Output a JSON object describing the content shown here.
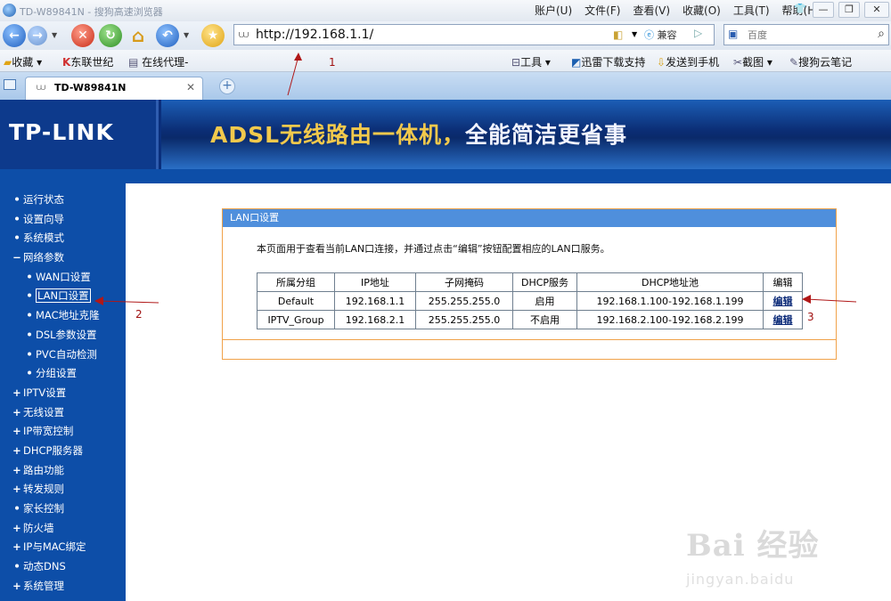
{
  "window": {
    "title": "TD-W89841N - 搜狗高速浏览器",
    "menu": [
      "账户(U)",
      "文件(F)",
      "查看(V)",
      "收藏(O)",
      "工具(T)",
      "帮助(H)"
    ]
  },
  "address_bar": {
    "url": "http://192.168.1.1/",
    "compat_label": "兼容",
    "search_placeholder": "百度"
  },
  "bookmarks": {
    "left": [
      "收藏",
      "东联世纪",
      "在线代理-"
    ],
    "right": [
      "工具",
      "迅雷下载支持",
      "发送到手机",
      "截图",
      "搜狗云笔记"
    ]
  },
  "tab": {
    "label": "TD-W89841N"
  },
  "router": {
    "logo": "TP-LINK",
    "banner_part1": "ADSL无线路由一体机，",
    "banner_part2": "全能简洁更省事"
  },
  "sidebar": {
    "items": [
      {
        "bullet": "•",
        "label": "运行状态",
        "sub": false,
        "selected": false
      },
      {
        "bullet": "•",
        "label": "设置向导",
        "sub": false,
        "selected": false
      },
      {
        "bullet": "•",
        "label": "系统模式",
        "sub": false,
        "selected": false
      },
      {
        "bullet": "−",
        "label": "网络参数",
        "sub": false,
        "selected": false
      },
      {
        "bullet": "•",
        "label": "WAN口设置",
        "sub": true,
        "selected": false
      },
      {
        "bullet": "•",
        "label": "LAN口设置",
        "sub": true,
        "selected": true
      },
      {
        "bullet": "•",
        "label": "MAC地址克隆",
        "sub": true,
        "selected": false
      },
      {
        "bullet": "•",
        "label": "DSL参数设置",
        "sub": true,
        "selected": false
      },
      {
        "bullet": "•",
        "label": "PVC自动检测",
        "sub": true,
        "selected": false
      },
      {
        "bullet": "•",
        "label": "分组设置",
        "sub": true,
        "selected": false
      },
      {
        "bullet": "+",
        "label": "IPTV设置",
        "sub": false,
        "selected": false
      },
      {
        "bullet": "+",
        "label": "无线设置",
        "sub": false,
        "selected": false
      },
      {
        "bullet": "+",
        "label": "IP带宽控制",
        "sub": false,
        "selected": false
      },
      {
        "bullet": "+",
        "label": "DHCP服务器",
        "sub": false,
        "selected": false
      },
      {
        "bullet": "+",
        "label": "路由功能",
        "sub": false,
        "selected": false
      },
      {
        "bullet": "+",
        "label": "转发规则",
        "sub": false,
        "selected": false
      },
      {
        "bullet": "•",
        "label": "家长控制",
        "sub": false,
        "selected": false
      },
      {
        "bullet": "+",
        "label": "防火墙",
        "sub": false,
        "selected": false
      },
      {
        "bullet": "+",
        "label": "IP与MAC绑定",
        "sub": false,
        "selected": false
      },
      {
        "bullet": "•",
        "label": "动态DNS",
        "sub": false,
        "selected": false
      },
      {
        "bullet": "+",
        "label": "系统管理",
        "sub": false,
        "selected": false
      }
    ]
  },
  "panel": {
    "title": "LAN口设置",
    "description": "本页面用于查看当前LAN口连接，并通过点击“编辑”按钮配置相应的LAN口服务。",
    "headers": [
      "所属分组",
      "IP地址",
      "子网掩码",
      "DHCP服务",
      "DHCP地址池",
      "编辑"
    ],
    "rows": [
      [
        "Default",
        "192.168.1.1",
        "255.255.255.0",
        "启用",
        "192.168.1.100-192.168.1.199",
        "编辑"
      ],
      [
        "IPTV_Group",
        "192.168.2.1",
        "255.255.255.0",
        "不启用",
        "192.168.2.100-192.168.2.199",
        "编辑"
      ]
    ]
  },
  "annotations": [
    "1",
    "2",
    "3"
  ],
  "watermark": {
    "logo": "Bai 经验",
    "url": "jingyan.baidu"
  }
}
